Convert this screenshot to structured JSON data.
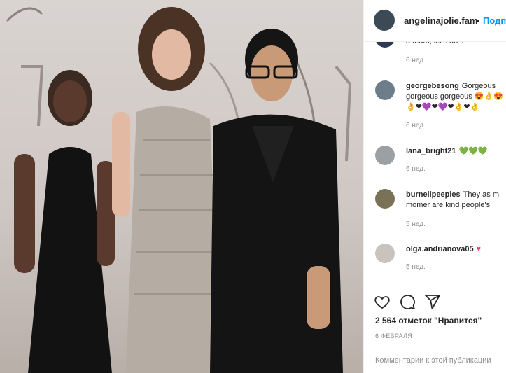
{
  "post": {
    "username": "angelinajolie.fam",
    "separator": "•",
    "follow_label": "Подпи",
    "likes_text": "2 564 отметок \"Нравится\"",
    "date": "6 ФЕВРАЛЯ",
    "comment_placeholder": "Комментарии к этой публикации",
    "partial_comment": "a team, let's do it",
    "partial_time": "6 нед."
  },
  "comments": [
    {
      "user": "georgebesong",
      "line1": "Gorgeous",
      "line2": "gorgeous gorgeous 😍👌😍",
      "line3": "👌❤💜❤💜❤👌❤👌",
      "time": "6 нед."
    },
    {
      "user": "lana_bright21",
      "line1": "💚💚💚",
      "line2": "",
      "line3": "",
      "time": "6 нед."
    },
    {
      "user": "burnellpeeples",
      "line1": "They as m",
      "line2": "momer are kind people's",
      "line3": "",
      "time": "5 нед."
    },
    {
      "user": "olga.andrianova05",
      "line1": "♥",
      "line2": "",
      "line3": "",
      "time": "5 нед."
    }
  ],
  "icons": {
    "like": "heart-outline-icon",
    "comment": "comment-bubble-icon",
    "share": "paper-plane-icon"
  },
  "colors": {
    "accent": "#0095f6",
    "text": "#262626",
    "muted": "#8e8e8e"
  }
}
